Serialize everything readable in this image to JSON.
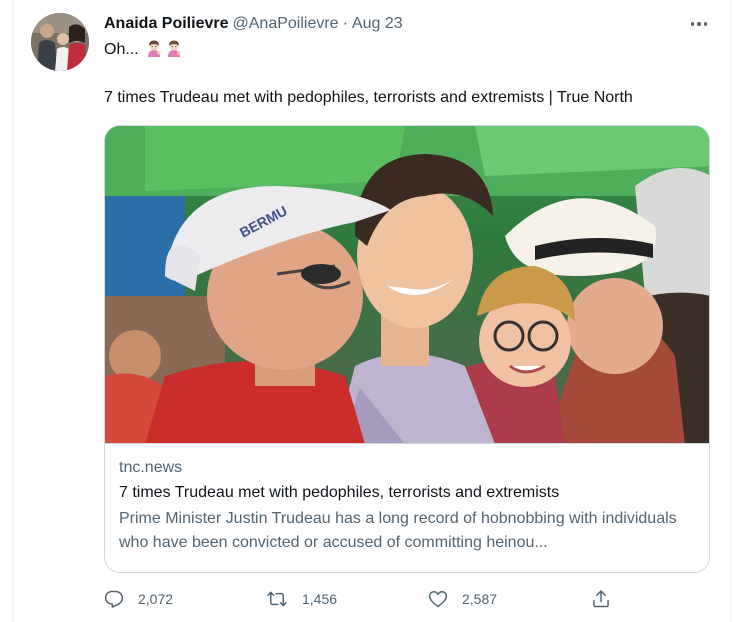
{
  "tweet": {
    "author": {
      "display_name": "Anaida Poilievre",
      "handle": "@AnaPoilievre",
      "separator": "·",
      "date": "Aug 23"
    },
    "text_line1": "Oh...",
    "emoji_count": 2,
    "text_line2": "7 times Trudeau met with pedophiles, terrorists and extremists | True North",
    "card": {
      "domain": "tnc.news",
      "title": "7 times Trudeau met with pedophiles, terrorists and extremists",
      "description": "Prime Minister Justin Trudeau has a long record of hobnobbing with individuals who have been convicted or accused of committing heinou...",
      "image_text": "BERMU"
    },
    "actions": {
      "replies": "2,072",
      "retweets": "1,456",
      "likes": "2,587"
    }
  },
  "icons": {
    "more": "more-icon",
    "reply": "reply-icon",
    "retweet": "retweet-icon",
    "like": "like-icon",
    "share": "share-icon",
    "emoji": "woman-tipping-hand-emoji"
  },
  "colors": {
    "text_primary": "#0f1419",
    "text_secondary": "#536471",
    "border": "#cfd9de"
  }
}
